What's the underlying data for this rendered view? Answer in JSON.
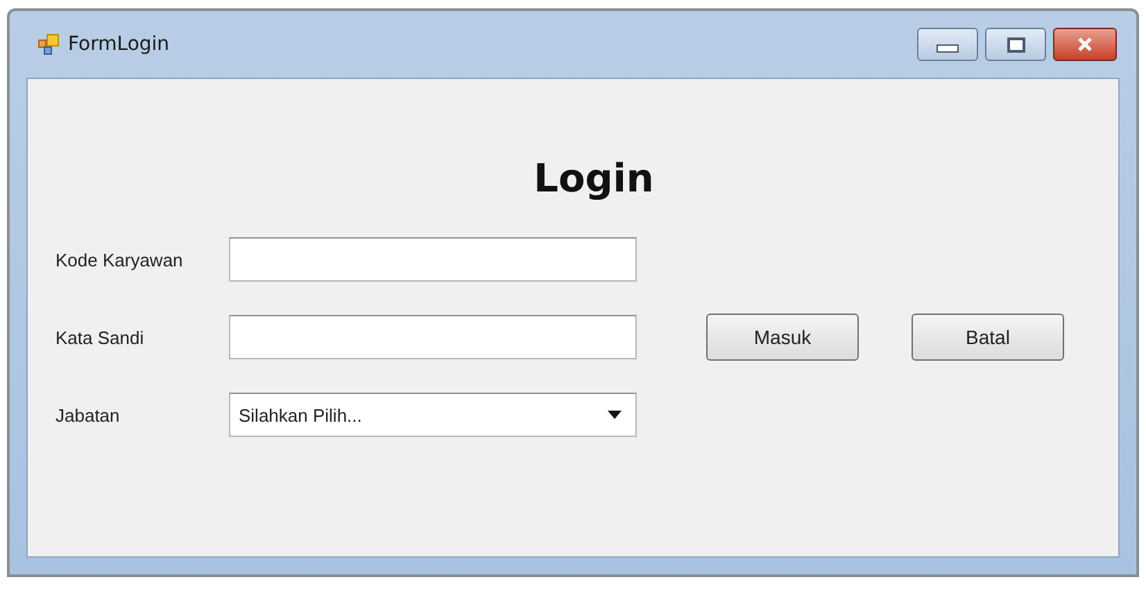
{
  "window": {
    "title": "FormLogin"
  },
  "heading": "Login",
  "fields": [
    {
      "label": "Kode Karyawan",
      "kind": "text"
    },
    {
      "label": "Kata Sandi",
      "kind": "text"
    },
    {
      "label": "Jabatan",
      "kind": "dropdown",
      "value": "Silahkan Pilih..."
    }
  ],
  "buttons": [
    "Masuk",
    "Batal"
  ]
}
